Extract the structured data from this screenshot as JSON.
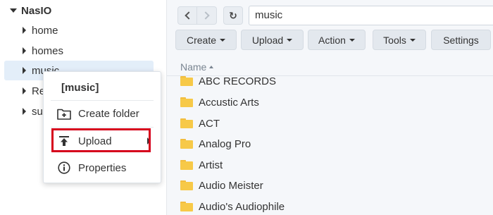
{
  "tree": {
    "root_label": "NasIO",
    "items": [
      {
        "label": "home"
      },
      {
        "label": "homes"
      },
      {
        "label": "music"
      },
      {
        "label": "Re"
      },
      {
        "label": "su"
      }
    ]
  },
  "toolbar": {
    "path_value": "music",
    "buttons": [
      {
        "label": "Create",
        "has_caret": true
      },
      {
        "label": "Upload",
        "has_caret": true
      },
      {
        "label": "Action",
        "has_caret": true
      },
      {
        "label": "Tools",
        "has_caret": true
      },
      {
        "label": "Settings",
        "has_caret": false
      }
    ]
  },
  "file_list": {
    "column_name": "Name",
    "rows": [
      {
        "name": "ABC RECORDS"
      },
      {
        "name": "Accustic Arts"
      },
      {
        "name": "ACT"
      },
      {
        "name": "Analog Pro"
      },
      {
        "name": "Artist"
      },
      {
        "name": "Audio Meister"
      },
      {
        "name": "Audio's Audiophile"
      }
    ]
  },
  "context_menu": {
    "title": "[music]",
    "items": [
      {
        "label": "Create folder",
        "icon": "create-folder-icon"
      },
      {
        "label": "Upload",
        "icon": "upload-icon",
        "has_submenu": true
      },
      {
        "label": "Properties",
        "icon": "info-icon"
      }
    ]
  },
  "colors": {
    "highlight_box": "#d6001c",
    "selected_row_bg": "#e3eef9",
    "folder": "#f7c948"
  }
}
